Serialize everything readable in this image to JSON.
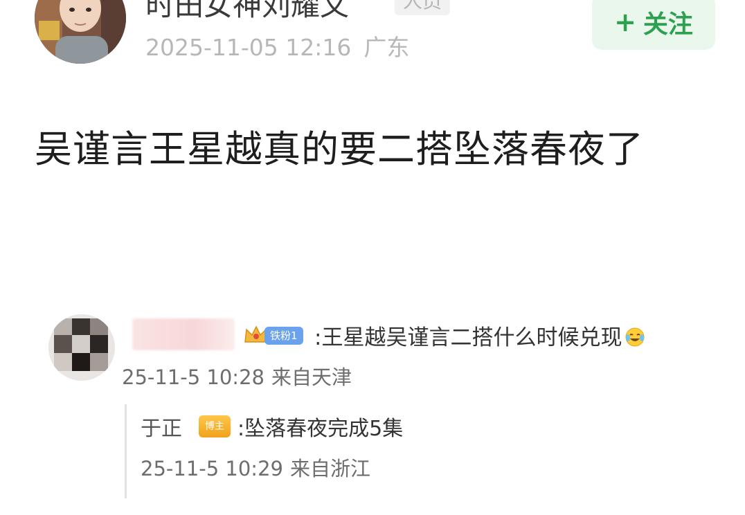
{
  "author": {
    "name": "时田女神刘耀文",
    "verified_label": "人员",
    "timestamp": "2025-11-05 12:16",
    "location": "广东"
  },
  "follow": {
    "plus": "+",
    "label": "关注"
  },
  "post": {
    "text": "吴谨言王星越真的要二搭坠落春夜了"
  },
  "embedded_comment": {
    "level_badge": "铁粉1",
    "text": ":王星越吴谨言二搭什么时候兑现",
    "timestamp": "25-11-5 10:28",
    "location": "来自天津",
    "reply": {
      "name": "于正",
      "badge": "博主",
      "text": ":坠落春夜完成5集",
      "timestamp": "25-11-5 10:29",
      "location": "来自浙江"
    }
  },
  "icons": {
    "avatar": "avatar-photo",
    "crown": "crown-icon",
    "emoji": "laugh-cry-emoji-icon"
  },
  "colors": {
    "follow_bg": "#eaf7ec",
    "follow_text": "#2ea150",
    "meta_gray": "#b7b7b7"
  }
}
